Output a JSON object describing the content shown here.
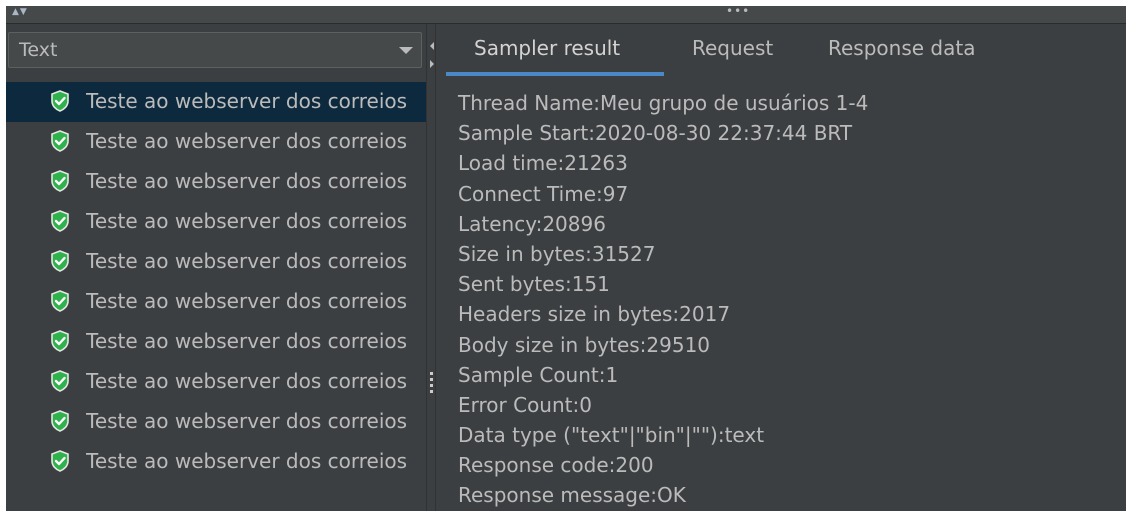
{
  "top_bar": {
    "arrows_icon": "sort-arrows-icon",
    "dots": "•••"
  },
  "left_panel": {
    "renderer": {
      "selected": "Text"
    },
    "results": [
      {
        "label": "Teste ao webserver dos correios",
        "status": "success",
        "selected": true
      },
      {
        "label": "Teste ao webserver dos correios",
        "status": "success",
        "selected": false
      },
      {
        "label": "Teste ao webserver dos correios",
        "status": "success",
        "selected": false
      },
      {
        "label": "Teste ao webserver dos correios",
        "status": "success",
        "selected": false
      },
      {
        "label": "Teste ao webserver dos correios",
        "status": "success",
        "selected": false
      },
      {
        "label": "Teste ao webserver dos correios",
        "status": "success",
        "selected": false
      },
      {
        "label": "Teste ao webserver dos correios",
        "status": "success",
        "selected": false
      },
      {
        "label": "Teste ao webserver dos correios",
        "status": "success",
        "selected": false
      },
      {
        "label": "Teste ao webserver dos correios",
        "status": "success",
        "selected": false
      },
      {
        "label": "Teste ao webserver dos correios",
        "status": "success",
        "selected": false
      }
    ]
  },
  "tabs": [
    {
      "label": "Sampler result",
      "active": true
    },
    {
      "label": "Request",
      "active": false
    },
    {
      "label": "Response data",
      "active": false
    }
  ],
  "sampler_result": [
    "Thread Name:Meu grupo de usuários 1-4",
    "Sample Start:2020-08-30 22:37:44 BRT",
    "Load time:21263",
    "Connect Time:97",
    "Latency:20896",
    "Size in bytes:31527",
    "Sent bytes:151",
    "Headers size in bytes:2017",
    "Body size in bytes:29510",
    "Sample Count:1",
    "Error Count:0",
    "Data type (\"text\"|\"bin\"|\"\"):text",
    "Response code:200",
    "Response message:OK"
  ],
  "colors": {
    "background": "#3c3f41",
    "text": "#bbbbbb",
    "selection": "#0d293e",
    "accent": "#4a88c7",
    "success": "#2fb24c"
  }
}
